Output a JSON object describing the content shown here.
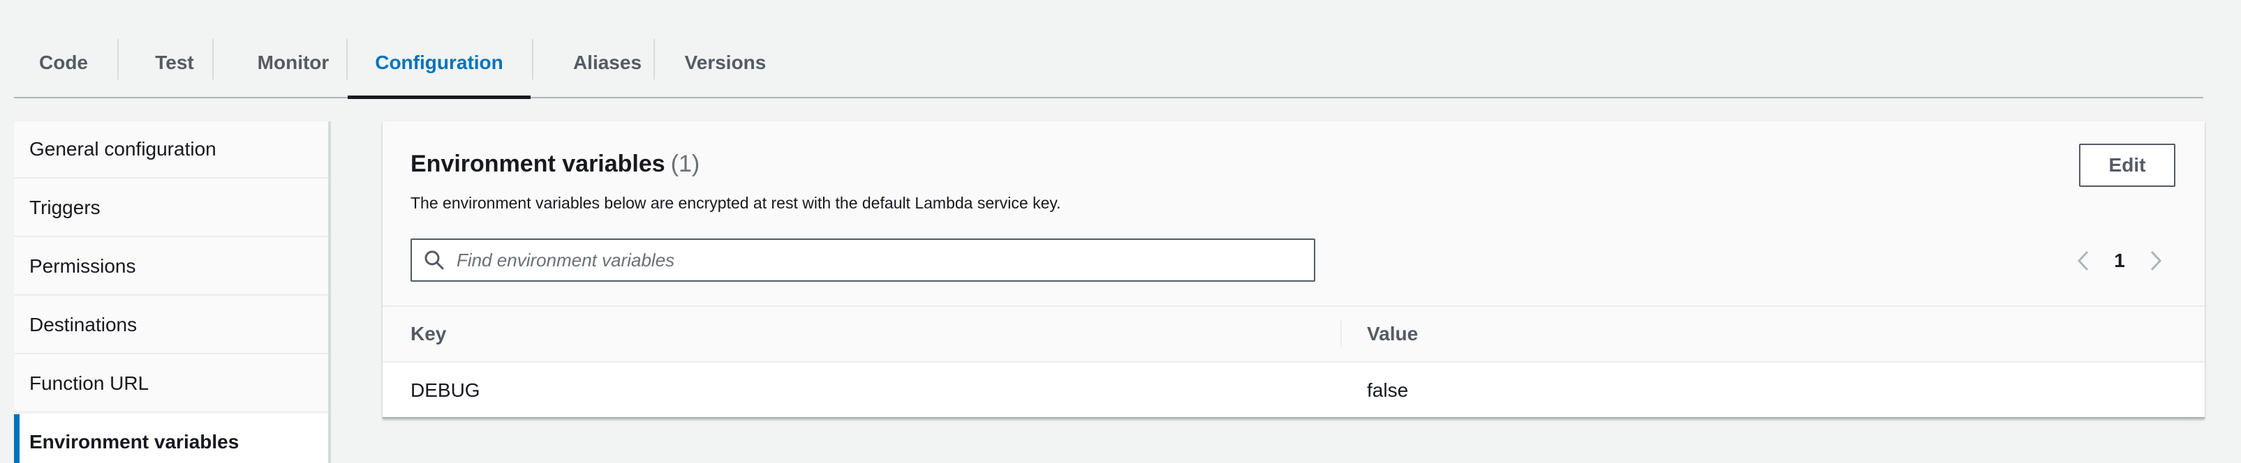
{
  "tabs": [
    {
      "label": "Code"
    },
    {
      "label": "Test"
    },
    {
      "label": "Monitor"
    },
    {
      "label": "Configuration"
    },
    {
      "label": "Aliases"
    },
    {
      "label": "Versions"
    }
  ],
  "active_tab": "Configuration",
  "sidebar": {
    "items": [
      {
        "label": "General configuration"
      },
      {
        "label": "Triggers"
      },
      {
        "label": "Permissions"
      },
      {
        "label": "Destinations"
      },
      {
        "label": "Function URL"
      },
      {
        "label": "Environment variables"
      }
    ],
    "active_item": "Environment variables"
  },
  "panel": {
    "title": "Environment variables",
    "count": "(1)",
    "description": "The environment variables below are encrypted at rest with the default Lambda service key.",
    "edit_label": "Edit"
  },
  "search": {
    "placeholder": "Find environment variables",
    "icon": "search-icon"
  },
  "pagination": {
    "current_page": "1",
    "prev_icon": "chevron-left-icon",
    "next_icon": "chevron-right-icon"
  },
  "table": {
    "columns": [
      "Key",
      "Value"
    ],
    "rows": [
      {
        "key": "DEBUG",
        "value": "false"
      }
    ]
  },
  "colors": {
    "accent": "#0073bb",
    "text": "#16191f",
    "muted": "#545b64",
    "background": "#f2f3f3"
  }
}
